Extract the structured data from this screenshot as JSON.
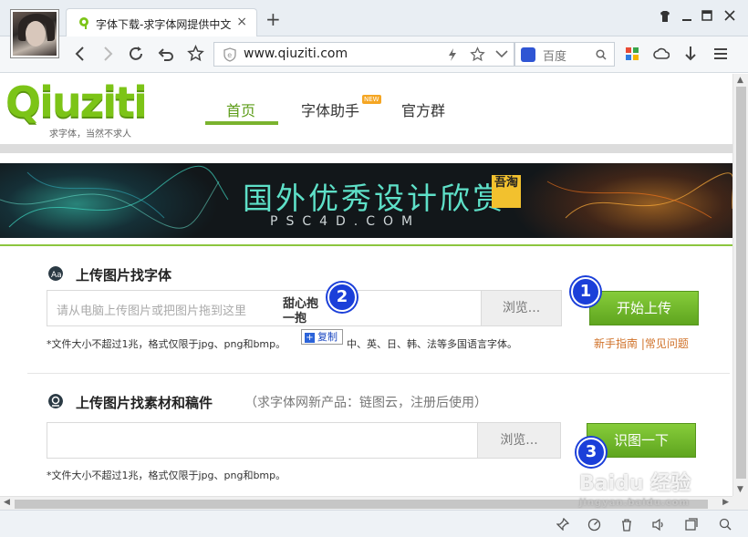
{
  "browser": {
    "tab_title": "字体下载-求字体网提供中文",
    "tab_close": "×",
    "new_tab": "+",
    "url": "www.qiuziti.com",
    "search_engine": "百度"
  },
  "site": {
    "logo_text": "Qiuziti",
    "logo_slogan": "求字体，当然不求人",
    "nav": {
      "home": "首页",
      "helper": "字体助手",
      "helper_badge": "NEW",
      "group": "官方群"
    },
    "banner": {
      "title": "国外优秀设计欣赏",
      "stamp": "吾淘",
      "subtitle": "PSC4D.COM"
    }
  },
  "section_font": {
    "title": "上传图片找字体",
    "placeholder": "请从电脑上传图片或把图片拖到这里",
    "browse": "浏览...",
    "button": "开始上传",
    "note": "*文件大小不超过1兆，格式仅限于jpg、png和bmp。",
    "note_tail": "中、英、日、韩、法等多国语言字体。",
    "links": "新手指南 |常见问题"
  },
  "section_material": {
    "title": "上传图片找素材和稿件",
    "note_title": "（求字体网新产品：链图云，注册后使用）",
    "browse": "浏览...",
    "button": "识图一下",
    "note": "*文件大小不超过1兆，格式仅限于jpg、png和bmp。"
  },
  "drag": {
    "image_text": "甜心抱一抱",
    "copy_label": "复制",
    "copy_plus": "+"
  },
  "markers": [
    "1",
    "2",
    "3"
  ],
  "watermark": {
    "line1": "Baidu 经验",
    "line2": "jingyan.baidu.com"
  },
  "colors": {
    "accent_green": "#7ab32e",
    "marker_blue": "#1b3fd9",
    "link_orange": "#d0722a"
  }
}
